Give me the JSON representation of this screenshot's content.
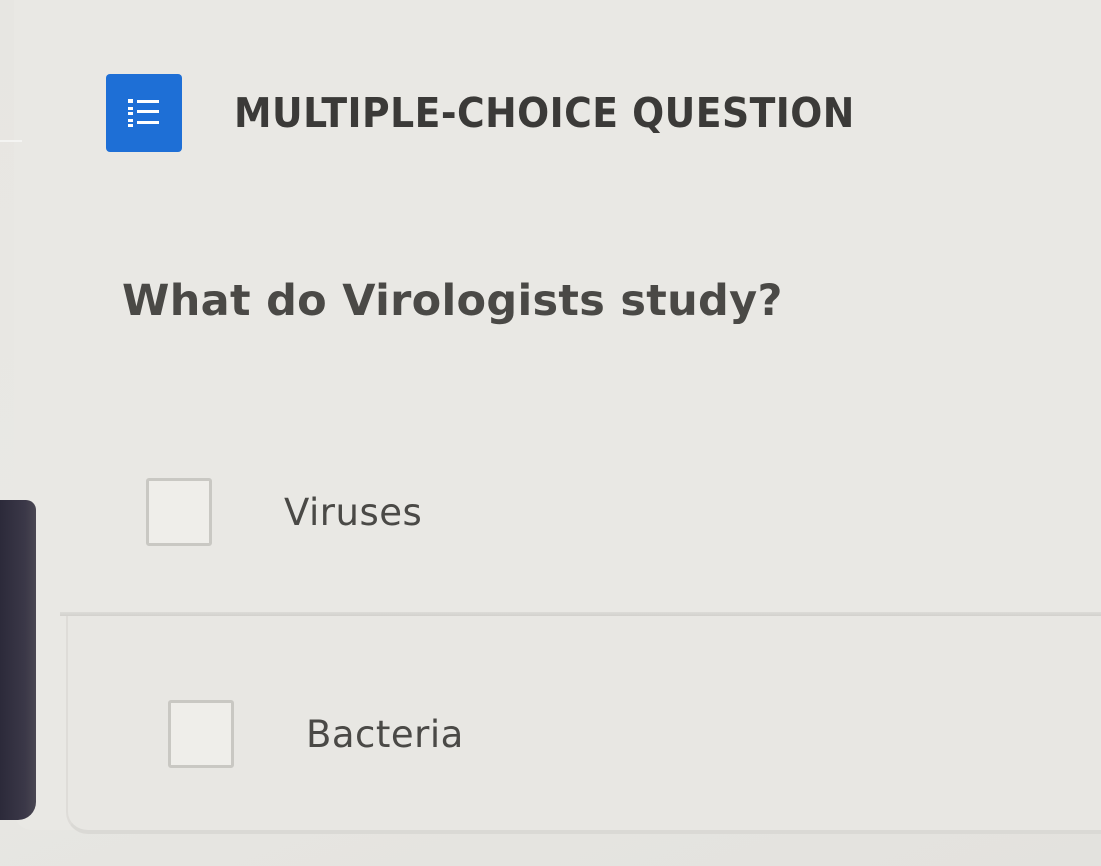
{
  "question_card": {
    "type_label": "MULTIPLE-CHOICE QUESTION",
    "type_icon": "numbered-list-icon",
    "accent_color": "#1e6fd6",
    "question_text": "What do Virologists study?",
    "options": [
      {
        "label": "Viruses",
        "checked": false
      },
      {
        "label": "Bacteria",
        "checked": false
      }
    ]
  }
}
